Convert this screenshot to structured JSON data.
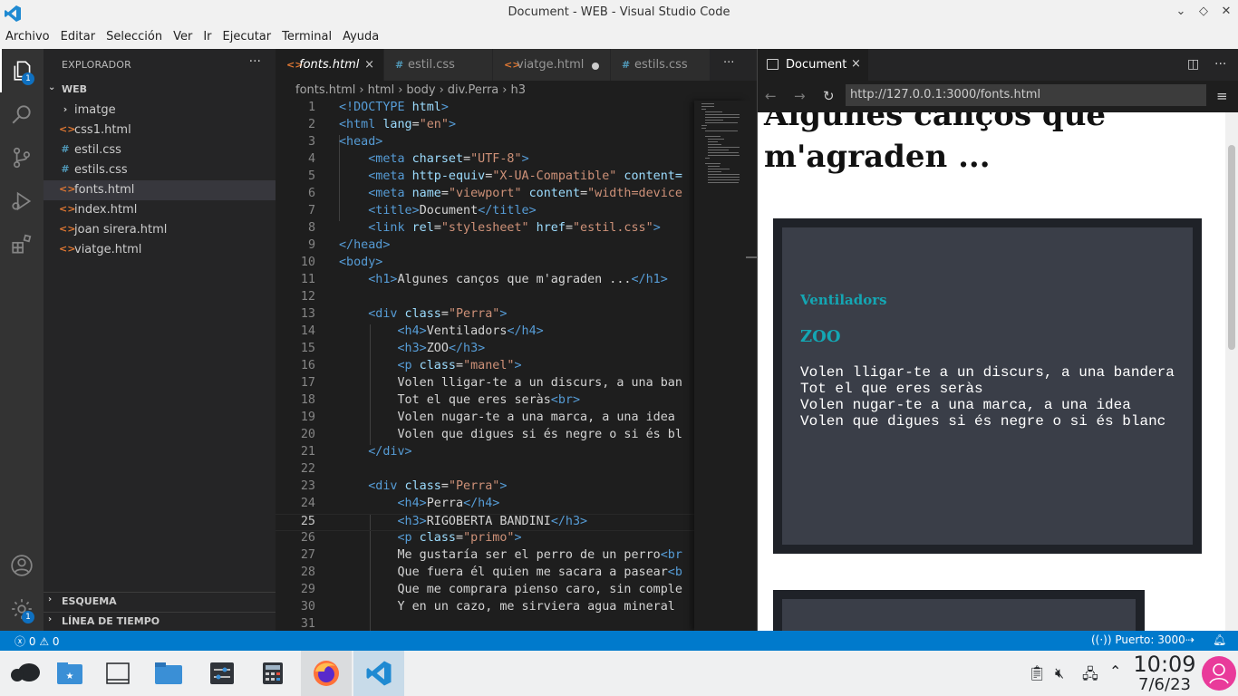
{
  "window": {
    "title": "Document - WEB - Visual Studio Code"
  },
  "menu": [
    "Archivo",
    "Editar",
    "Selección",
    "Ver",
    "Ir",
    "Ejecutar",
    "Terminal",
    "Ayuda"
  ],
  "activity": {
    "explorer_badge": "1",
    "accounts_badge": "1"
  },
  "sidebar": {
    "header": "EXPLORADOR",
    "more": "···",
    "folder": "WEB",
    "items": [
      {
        "label": "imatge",
        "icon": "chevron-right-icon",
        "glyph": "›"
      },
      {
        "label": "css1.html",
        "icon": "html-file-icon",
        "glyph": "<>",
        "color": "#e37933"
      },
      {
        "label": "estil.css",
        "icon": "css-file-icon",
        "glyph": "#",
        "color": "#519aba"
      },
      {
        "label": "estils.css",
        "icon": "css-file-icon",
        "glyph": "#",
        "color": "#519aba"
      },
      {
        "label": "fonts.html",
        "icon": "html-file-icon",
        "glyph": "<>",
        "color": "#e37933"
      },
      {
        "label": "index.html",
        "icon": "html-file-icon",
        "glyph": "<>",
        "color": "#e37933"
      },
      {
        "label": "joan sirera.html",
        "icon": "html-file-icon",
        "glyph": "<>",
        "color": "#e37933"
      },
      {
        "label": "viatge.html",
        "icon": "html-file-icon",
        "glyph": "<>",
        "color": "#e37933"
      }
    ],
    "outline": "ESQUEMA",
    "timeline": "LÍNEA DE TIEMPO"
  },
  "editor": {
    "tabs": [
      {
        "label": "fonts.html",
        "glyph": "<>",
        "color": "#e37933",
        "active": true,
        "close": "×"
      },
      {
        "label": "estil.css",
        "glyph": "#",
        "color": "#519aba"
      },
      {
        "label": "viatge.html",
        "glyph": "<>",
        "color": "#e37933",
        "dirty": true
      },
      {
        "label": "estils.css",
        "glyph": "#",
        "color": "#519aba"
      }
    ],
    "tabs_more": "···",
    "breadcrumb": [
      "fonts.html",
      "html",
      "body",
      "div.Perra",
      "h3"
    ],
    "current_line": 25,
    "lines": [
      [
        [
          "t",
          "<!DOCTYPE"
        ],
        [
          "a",
          " html"
        ],
        [
          "t",
          ">"
        ]
      ],
      [
        [
          "t",
          "<html"
        ],
        [
          "a",
          " lang"
        ],
        [
          "x",
          "="
        ],
        [
          "s",
          "\"en\""
        ],
        [
          "t",
          ">"
        ]
      ],
      [
        [
          "t",
          "<head>"
        ]
      ],
      [
        [
          "x",
          "    "
        ],
        [
          "t",
          "<meta"
        ],
        [
          "a",
          " charset"
        ],
        [
          "x",
          "="
        ],
        [
          "s",
          "\"UTF-8\""
        ],
        [
          "t",
          ">"
        ]
      ],
      [
        [
          "x",
          "    "
        ],
        [
          "t",
          "<meta"
        ],
        [
          "a",
          " http-equiv"
        ],
        [
          "x",
          "="
        ],
        [
          "s",
          "\"X-UA-Compatible\""
        ],
        [
          "a",
          " content="
        ]
      ],
      [
        [
          "x",
          "    "
        ],
        [
          "t",
          "<meta"
        ],
        [
          "a",
          " name"
        ],
        [
          "x",
          "="
        ],
        [
          "s",
          "\"viewport\""
        ],
        [
          "a",
          " content"
        ],
        [
          "x",
          "="
        ],
        [
          "s",
          "\"width=device"
        ]
      ],
      [
        [
          "x",
          "    "
        ],
        [
          "t",
          "<title>"
        ],
        [
          "x",
          "Document"
        ],
        [
          "t",
          "</title>"
        ]
      ],
      [
        [
          "x",
          "    "
        ],
        [
          "t",
          "<link"
        ],
        [
          "a",
          " rel"
        ],
        [
          "x",
          "="
        ],
        [
          "s",
          "\"stylesheet\""
        ],
        [
          "a",
          " href"
        ],
        [
          "x",
          "="
        ],
        [
          "s",
          "\"estil.css\""
        ],
        [
          "t",
          ">"
        ]
      ],
      [
        [
          "t",
          "</head>"
        ]
      ],
      [
        [
          "t",
          "<body>"
        ]
      ],
      [
        [
          "x",
          "    "
        ],
        [
          "t",
          "<h1>"
        ],
        [
          "x",
          "Algunes canços que m'agraden ..."
        ],
        [
          "t",
          "</h1>"
        ]
      ],
      [],
      [
        [
          "x",
          "    "
        ],
        [
          "t",
          "<div"
        ],
        [
          "a",
          " class"
        ],
        [
          "x",
          "="
        ],
        [
          "s",
          "\"Perra\""
        ],
        [
          "t",
          ">"
        ]
      ],
      [
        [
          "x",
          "        "
        ],
        [
          "t",
          "<h4>"
        ],
        [
          "x",
          "Ventiladors"
        ],
        [
          "t",
          "</h4>"
        ]
      ],
      [
        [
          "x",
          "        "
        ],
        [
          "t",
          "<h3>"
        ],
        [
          "x",
          "ZOO"
        ],
        [
          "t",
          "</h3>"
        ]
      ],
      [
        [
          "x",
          "        "
        ],
        [
          "t",
          "<p"
        ],
        [
          "a",
          " class"
        ],
        [
          "x",
          "="
        ],
        [
          "s",
          "\"manel\""
        ],
        [
          "t",
          ">"
        ]
      ],
      [
        [
          "x",
          "        Volen lligar-te a un discurs, a una ban"
        ]
      ],
      [
        [
          "x",
          "        Tot el que eres seràs"
        ],
        [
          "t",
          "<br>"
        ]
      ],
      [
        [
          "x",
          "        Volen nugar-te a una marca, a una idea"
        ]
      ],
      [
        [
          "x",
          "        Volen que digues si és negre o si és bl"
        ]
      ],
      [
        [
          "x",
          "    "
        ],
        [
          "t",
          "</div>"
        ]
      ],
      [],
      [
        [
          "x",
          "    "
        ],
        [
          "t",
          "<div"
        ],
        [
          "a",
          " class"
        ],
        [
          "x",
          "="
        ],
        [
          "s",
          "\"Perra\""
        ],
        [
          "t",
          ">"
        ]
      ],
      [
        [
          "x",
          "        "
        ],
        [
          "t",
          "<h4>"
        ],
        [
          "x",
          "Perra"
        ],
        [
          "t",
          "</h4>"
        ]
      ],
      [
        [
          "x",
          "        "
        ],
        [
          "t",
          "<h3>"
        ],
        [
          "x",
          "RIGOBERTA BANDINI"
        ],
        [
          "t",
          "</h3>"
        ]
      ],
      [
        [
          "x",
          "        "
        ],
        [
          "t",
          "<p"
        ],
        [
          "a",
          " class"
        ],
        [
          "x",
          "="
        ],
        [
          "s",
          "\"primo\""
        ],
        [
          "t",
          ">"
        ]
      ],
      [
        [
          "x",
          "        Me gustaría ser el perro de un perro"
        ],
        [
          "t",
          "<br"
        ]
      ],
      [
        [
          "x",
          "        Que fuera él quien me sacara a pasear"
        ],
        [
          "t",
          "<b"
        ]
      ],
      [
        [
          "x",
          "        Que me comprara pienso caro, sin comple"
        ]
      ],
      [
        [
          "x",
          "        Y en un cazo, me sirviera agua mineral"
        ]
      ],
      []
    ]
  },
  "preview": {
    "tab": "Document",
    "tab_close": "×",
    "url": "http://127.0.0.1:3000/fonts.html",
    "h1": "Algunes canços que m'agraden ...",
    "card": {
      "h4": "Ventiladors",
      "h3": "ZOO",
      "p": "Volen lligar-te a un discurs, a una bandera\nTot el que eres seràs\nVolen nugar-te a una marca, a una idea\nVolen que digues si és negre o si és blanc"
    }
  },
  "status": {
    "errors": "0",
    "warnings": "0",
    "port": "Puerto: 3000"
  },
  "taskbar": {
    "time": "10:09",
    "date": "7/6/23"
  },
  "colors": {
    "accent": "#007acc",
    "html": "#e37933",
    "css": "#519aba",
    "heading": "#14a6b3"
  }
}
